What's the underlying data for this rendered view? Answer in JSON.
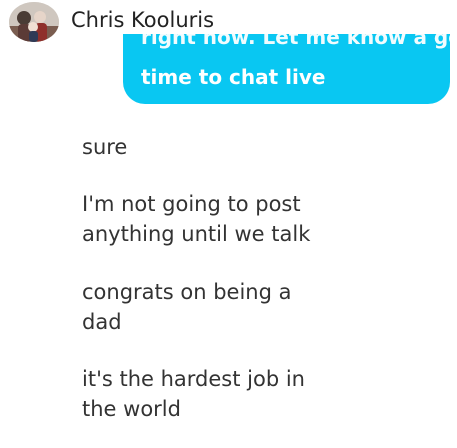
{
  "header": {
    "contact_name": "Chris Kooluris",
    "avatar_icon": "profile-photo"
  },
  "outgoing_message": {
    "clipped_line": "right now. Let me know a good",
    "line": "time to chat live",
    "color": "#09c7f2"
  },
  "incoming_messages": [
    {
      "lines": [
        "sure"
      ]
    },
    {
      "lines": [
        "I'm not going to post",
        "anything until we talk"
      ]
    },
    {
      "lines": [
        "congrats on being a",
        "dad"
      ]
    },
    {
      "lines": [
        "it's the hardest job in",
        "the world"
      ]
    }
  ]
}
